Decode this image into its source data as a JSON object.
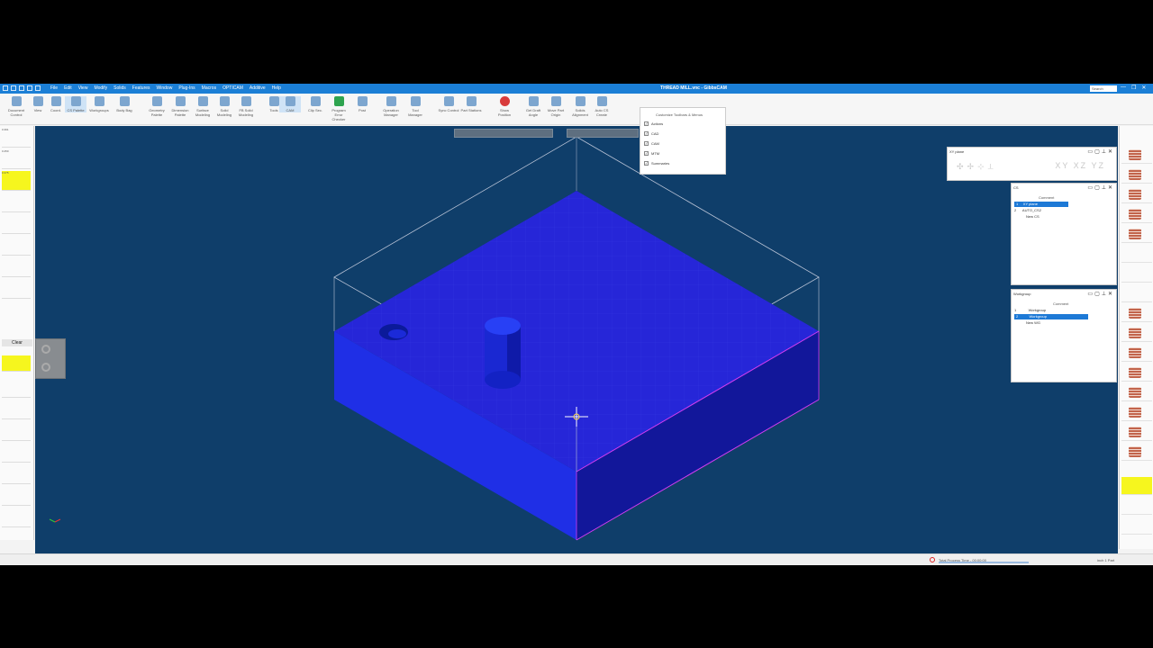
{
  "window": {
    "title": "THREAD MILL.vnc - GibbsCAM",
    "search": "Search",
    "controls": [
      "—",
      "❐",
      "✕"
    ]
  },
  "menu": [
    "File",
    "Edit",
    "View",
    "Modify",
    "Solids",
    "Features",
    "Window",
    "Plug-Ins",
    "Macros",
    "OPTICAM",
    "Additive",
    "Help"
  ],
  "ribbon": {
    "buttons": [
      {
        "label": "Document Control",
        "icon": "document-control-icon"
      },
      {
        "label": "View",
        "icon": "view-icon"
      },
      {
        "label": "Coord.",
        "icon": "coordinate-icon"
      },
      {
        "label": "CS Palette",
        "icon": "cs-palette-icon"
      },
      {
        "label": "Workgroups",
        "icon": "workgroups-icon"
      },
      {
        "label": "Body Bag",
        "icon": "body-bag-icon"
      },
      {
        "label": "Geometry Palette",
        "icon": "geometry-palette-icon"
      },
      {
        "label": "Dimension Palette",
        "icon": "dimension-palette-icon"
      },
      {
        "label": "Surface Modeling",
        "icon": "surface-modeling-icon"
      },
      {
        "label": "Solid Modeling",
        "icon": "solid-modeling-icon"
      },
      {
        "label": "FB Solid Modeling",
        "icon": "fb-solid-modeling-icon"
      },
      {
        "label": "Tools",
        "icon": "tools-icon"
      },
      {
        "label": "CAM",
        "icon": "cam-icon"
      },
      {
        "label": "Clip Sec.",
        "icon": "clip-section-icon"
      },
      {
        "label": "Program Error Checker",
        "icon": "error-checker-icon"
      },
      {
        "label": "Post",
        "icon": "post-icon"
      },
      {
        "label": "Operation Manager",
        "icon": "operation-manager-icon"
      },
      {
        "label": "Tool Manager",
        "icon": "tool-manager-icon"
      },
      {
        "label": "Sync Control",
        "icon": "sync-control-icon"
      },
      {
        "label": "Part Stations",
        "icon": "part-stations-icon"
      },
      {
        "label": "Show Position",
        "icon": "show-position-icon"
      },
      {
        "label": "Get Draft Angle",
        "icon": "draft-angle-icon"
      },
      {
        "label": "Move Part Origin",
        "icon": "move-origin-icon"
      },
      {
        "label": "Solids Alignment",
        "icon": "solids-alignment-icon"
      },
      {
        "label": "Auto CS Create",
        "icon": "auto-cs-icon"
      }
    ],
    "customize": {
      "title": "Customize Toolbars & Menus",
      "items": [
        {
          "label": "Actions",
          "checked": true
        },
        {
          "label": "CAD",
          "checked": true
        },
        {
          "label": "CAM",
          "checked": true
        },
        {
          "label": "MTM",
          "checked": true
        },
        {
          "label": "Summaries",
          "checked": true
        }
      ]
    }
  },
  "left_palette": {
    "tools": [
      "0.391",
      "0.250",
      "0.375",
      "",
      "",
      "",
      "",
      ""
    ],
    "clear_label": "Clear"
  },
  "panels": {
    "xyplane": {
      "title": "XY plane",
      "modes": "XY XZ YZ"
    },
    "cs": {
      "title": "CS",
      "header": "Comment",
      "rows": [
        {
          "num": "1",
          "name": "XY plane",
          "selected": true
        },
        {
          "num": "2",
          "name": "AUTO_CS2",
          "selected": false
        },
        {
          "num": "",
          "name": "New CS",
          "selected": false
        }
      ]
    },
    "workgroup": {
      "title": "Workgroup",
      "header": "Comment",
      "rows": [
        {
          "num": "1",
          "name": "Workgroup",
          "selected": false
        },
        {
          "num": "2",
          "name": "Workgroup",
          "selected": true
        },
        {
          "num": "",
          "name": "New WG",
          "selected": false
        }
      ]
    }
  },
  "status": {
    "process_time": "Total Process Time - 00:00:00",
    "units": "inch   1 Part"
  },
  "colors": {
    "titlebar": "#1b7fd6",
    "viewport": "#0f3e6a",
    "part_top": "#2626d8",
    "part_front": "#1f2fe6",
    "part_right": "#12179a",
    "highlight_yellow": "#f6f61e"
  }
}
